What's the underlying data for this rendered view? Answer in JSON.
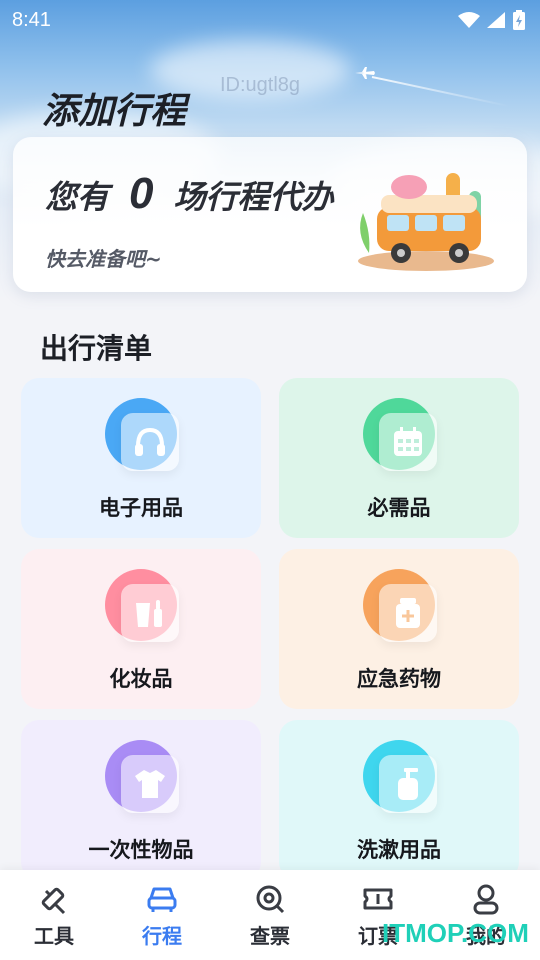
{
  "status": {
    "time": "8:41"
  },
  "header": {
    "title": "添加行程",
    "id_watermark": "ID:ugtl8g"
  },
  "todo_card": {
    "prefix": "您有",
    "count": "0",
    "suffix": "场行程代办",
    "subtitle": "快去准备吧~"
  },
  "checklist": {
    "title": "出行清单",
    "items": [
      {
        "label": "电子用品",
        "icon": "headphones-icon",
        "bg": "#e7f2ff",
        "badge": "#4aa8f5"
      },
      {
        "label": "必需品",
        "icon": "calendar-icon",
        "bg": "#ddf5ea",
        "badge": "#4fd89a"
      },
      {
        "label": "化妆品",
        "icon": "cosmetics-icon",
        "bg": "#fdeff2",
        "badge": "#ff8ea0"
      },
      {
        "label": "应急药物",
        "icon": "medicine-kit-icon",
        "bg": "#fdf0e4",
        "badge": "#f7a35c"
      },
      {
        "label": "一次性物品",
        "icon": "tshirt-icon",
        "bg": "#f1edfd",
        "badge": "#a98cf5"
      },
      {
        "label": "洗漱用品",
        "icon": "soap-bottle-icon",
        "bg": "#e0f8f9",
        "badge": "#3fd6ee"
      }
    ]
  },
  "tabbar": {
    "active": "行程",
    "items": [
      {
        "label": "工具",
        "icon": "tools-icon"
      },
      {
        "label": "行程",
        "icon": "car-icon"
      },
      {
        "label": "查票",
        "icon": "search-ticket-icon"
      },
      {
        "label": "订票",
        "icon": "ticket-icon"
      },
      {
        "label": "我的",
        "icon": "user-icon"
      }
    ]
  },
  "watermark": {
    "site": "ITMOP.COM"
  },
  "colors": {
    "accent": "#3b7cf0",
    "watermark": "#1fd0b8"
  }
}
